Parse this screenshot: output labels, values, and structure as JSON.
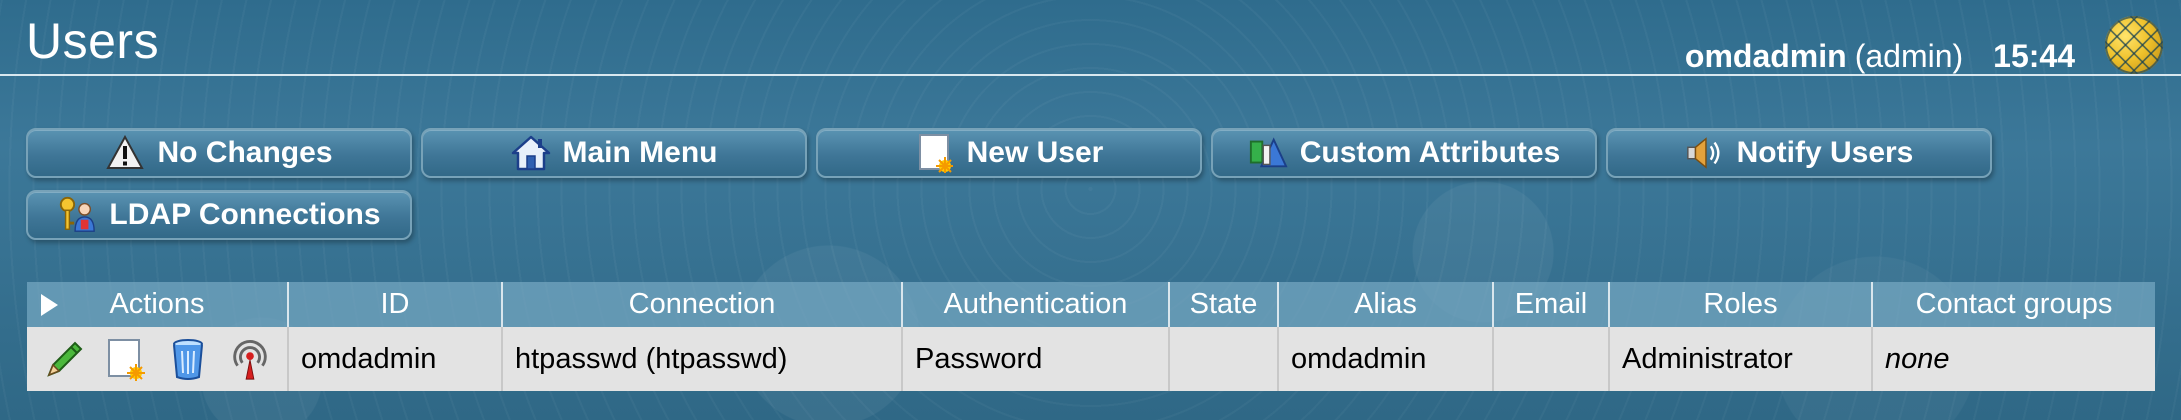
{
  "header": {
    "title": "Users",
    "username": "omdadmin",
    "role": "(admin)",
    "time": "15:44",
    "logo_icon": "globe-icon"
  },
  "buttons": [
    {
      "label": "No Changes",
      "icon": "warning-icon"
    },
    {
      "label": "Main Menu",
      "icon": "home-icon"
    },
    {
      "label": "New User",
      "icon": "new-document-icon"
    },
    {
      "label": "Custom Attributes",
      "icon": "custom-attributes-icon"
    },
    {
      "label": "Notify Users",
      "icon": "speaker-icon"
    },
    {
      "label": "LDAP Connections",
      "icon": "ldap-icon"
    }
  ],
  "table": {
    "columns": [
      "Actions",
      "ID",
      "Connection",
      "Authentication",
      "State",
      "Alias",
      "Email",
      "Roles",
      "Contact groups"
    ],
    "rows": [
      {
        "actions": [
          "edit-icon",
          "clone-icon",
          "delete-icon",
          "notify-icon"
        ],
        "id": "omdadmin",
        "connection": "htpasswd (htpasswd)",
        "authentication": "Password",
        "state": "",
        "alias": "omdadmin",
        "email": "",
        "roles": "Administrator",
        "contact_groups": "none"
      }
    ]
  },
  "colors": {
    "background": "#2f6c8d",
    "button": "#4a84a5",
    "table_header": "#78aac3",
    "table_row": "#e3e3e3"
  }
}
